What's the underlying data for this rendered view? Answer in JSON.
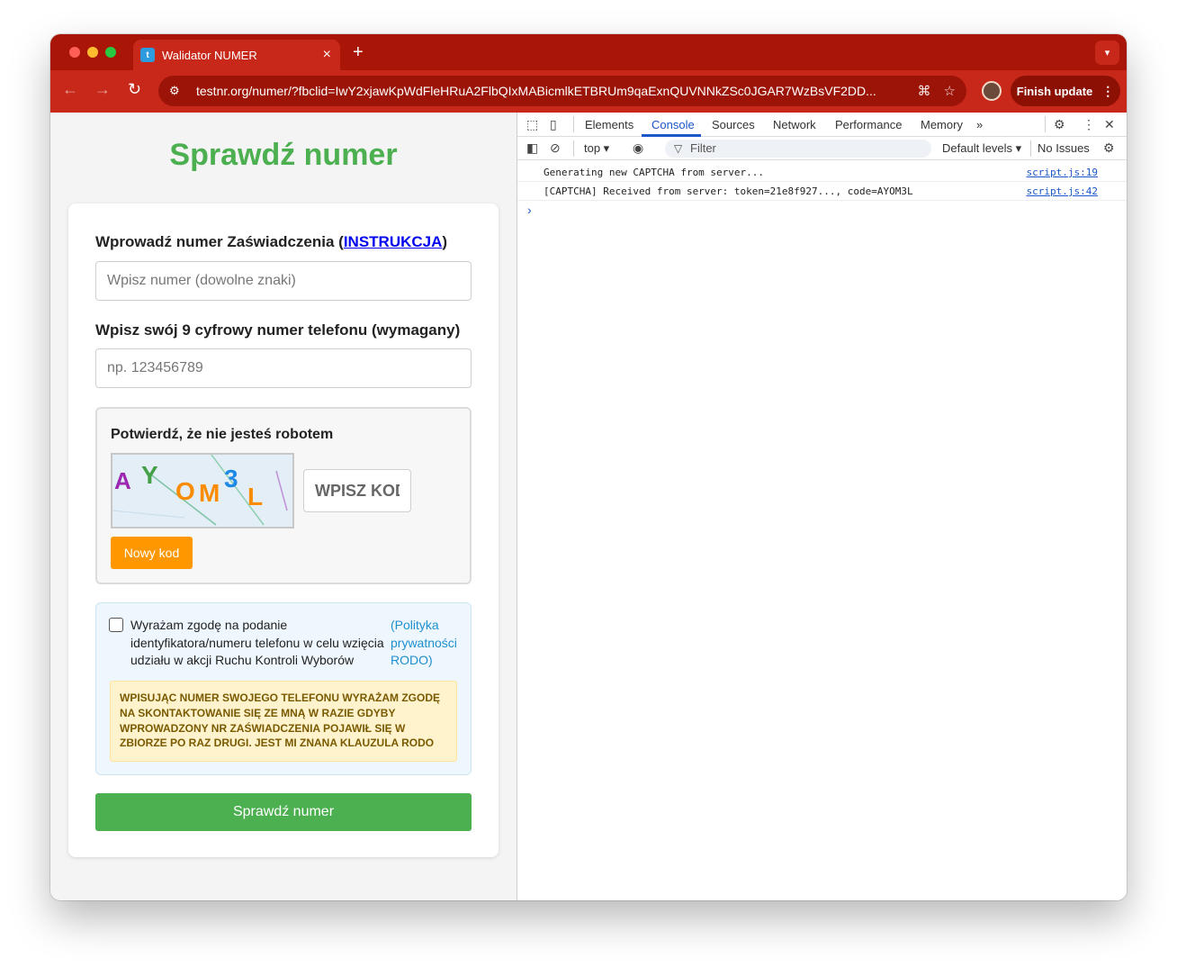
{
  "browser": {
    "tab_title": "Walidator NUMER",
    "tab_favicon_letter": "t",
    "tab_close": "×",
    "new_tab": "+",
    "url": "testnr.org/numer/?fbclid=IwY2xjawKpWdFleHRuA2FlbQIxMABicmlkETBRUm9qaExnQUVNNkZSc0JGAR7WzBsVF2DD...",
    "finish_update": "Finish update",
    "colors": {
      "frame": "#a91608",
      "toolbar": "#c8281a"
    }
  },
  "page": {
    "title": "Sprawdź numer",
    "cert_label_prefix": "Wprowadź numer Zaświadczenia (",
    "cert_label_link": "INSTRUKCJA",
    "cert_label_suffix": ")",
    "cert_placeholder": "Wpisz numer (dowolne znaki)",
    "phone_label": "Wpisz swój 9 cyfrowy numer telefonu (wymagany)",
    "phone_placeholder": "np. 123456789",
    "captcha": {
      "title": "Potwierdź, że nie jesteś robotem",
      "chars": [
        "A",
        "Y",
        "O",
        "M",
        "3",
        "L"
      ],
      "input_placeholder": "WPISZ KOD",
      "refresh_label": "Nowy kod"
    },
    "consent": {
      "text": "Wyrażam zgodę na podanie identyfikatora/numeru telefonu w celu wzięcia udziału w akcji Ruchu Kontroli Wyborów",
      "link": "(Polityka prywatności RODO)",
      "warning": "WPISUJĄC NUMER SWOJEGO TELEFONU WYRAŻAM ZGODĘ NA SKONTAKTOWANIE SIĘ ZE MNĄ W RAZIE GDYBY WPROWADZONY NR ZAŚWIADCZENIA POJAWIŁ SIĘ W ZBIORZE PO RAZ DRUGI. JEST MI ZNANA KLAUZULA RODO"
    },
    "submit_label": "Sprawdź numer",
    "colors": {
      "accent": "#4caf50",
      "orange": "#ff9800"
    }
  },
  "devtools": {
    "tabs": [
      "Elements",
      "Console",
      "Sources",
      "Network",
      "Performance",
      "Memory"
    ],
    "more": "»",
    "context": "top ▾",
    "filter_placeholder": "Filter",
    "levels": "Default levels ▾",
    "issues": "No Issues",
    "console": [
      {
        "message": "Generating new CAPTCHA from server...",
        "source": "script.js:19"
      },
      {
        "message": "[CAPTCHA] Received from server: token=21e8f927..., code=AYOM3L",
        "source": "script.js:42"
      }
    ],
    "prompt": "›"
  }
}
